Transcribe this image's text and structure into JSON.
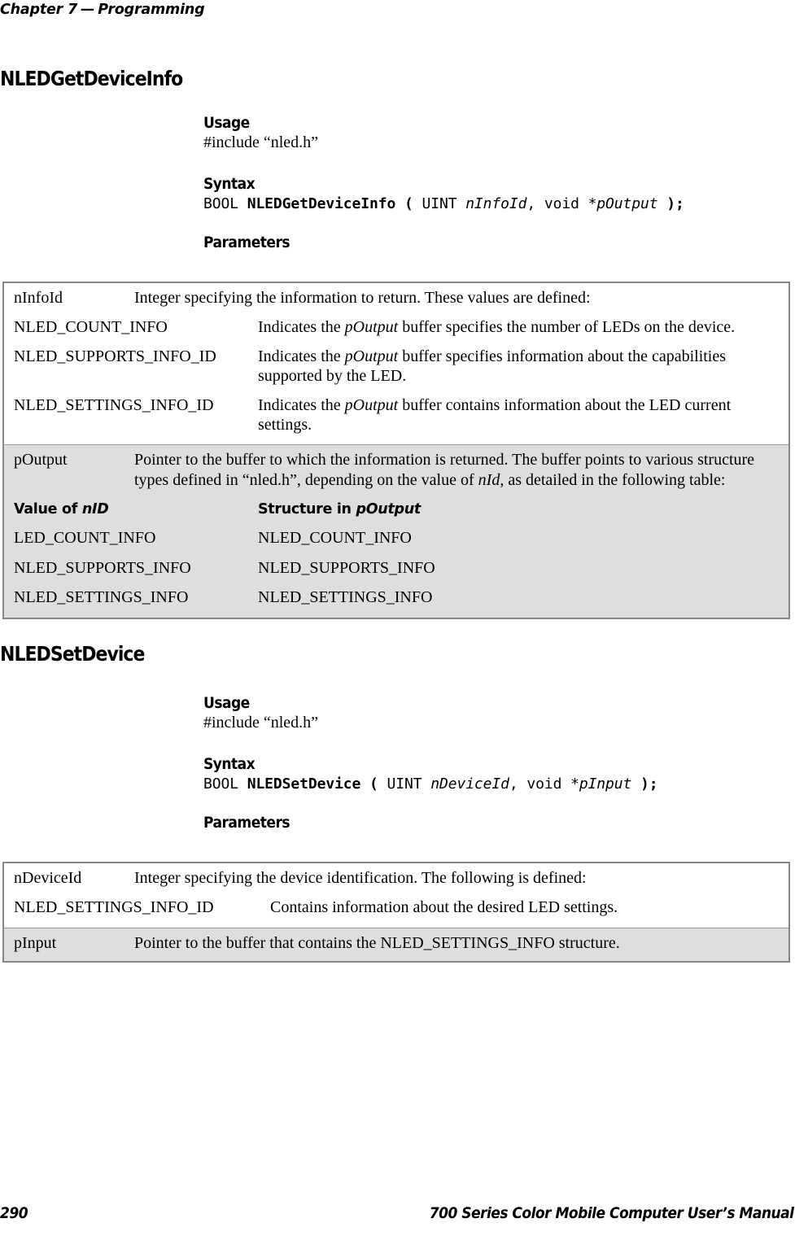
{
  "header": {
    "chapter": "Chapter 7",
    "dash": "—",
    "title": "Programming"
  },
  "sections": [
    {
      "heading": "NLEDGetDeviceInfo",
      "usage_label": "Usage",
      "usage_text": "#include “nled.h”",
      "syntax_label": "Syntax",
      "syntax": {
        "return_type": "BOOL",
        "function_name": "NLEDGetDeviceInfo",
        "paren_open": "(",
        "arg1_type": "UINT",
        "arg1_name": "nInfoId",
        "comma": ",",
        "arg2_type": "void",
        "arg2_name": "*pOutput",
        "paren_close": ");"
      },
      "parameters_label": "Parameters"
    },
    {
      "heading": "NLEDSetDevice",
      "usage_label": "Usage",
      "usage_text": "#include “nled.h”",
      "syntax_label": "Syntax",
      "syntax": {
        "return_type": "BOOL",
        "function_name": "NLEDSetDevice",
        "paren_open": "(",
        "arg1_type": "UINT",
        "arg1_name": "nDeviceId",
        "comma": ",",
        "arg2_type": "void",
        "arg2_name": "*pInput",
        "paren_close": ");"
      },
      "parameters_label": "Parameters"
    }
  ],
  "table1": {
    "row_ninfoid": {
      "label": "nInfoId",
      "intro": "Integer specifying the information to return. These values are defined:",
      "definitions": [
        {
          "term": "NLED_COUNT_INFO",
          "desc_pre": "Indicates the ",
          "desc_em": "pOutput",
          "desc_post": " buffer specifies the number of LEDs on the device."
        },
        {
          "term": "NLED_SUPPORTS_INFO_ID",
          "desc_pre": "Indicates the ",
          "desc_em": "pOutput",
          "desc_post": " buffer specifies information about the capabilities supported by the LED."
        },
        {
          "term": "NLED_SETTINGS_INFO_ID",
          "desc_pre": "Indicates the ",
          "desc_em": "pOutput",
          "desc_post": " buffer contains information about the LED current settings."
        }
      ]
    },
    "row_poutput": {
      "label": "pOutput",
      "intro_pre": "Pointer to the buffer to which the information is returned. The buffer points to various structure types defined in “nled.h”, depending on the value of ",
      "intro_em": "nId",
      "intro_post": ", as detailed in the following table:",
      "inner_header": {
        "col_a_pre": "Value of ",
        "col_a_em": "nID",
        "col_b_pre": "Structure in ",
        "col_b_em": "pOutput"
      },
      "inner_rows": [
        {
          "value": "LED_COUNT_INFO",
          "structure": "NLED_COUNT_INFO"
        },
        {
          "value": "NLED_SUPPORTS_INFO",
          "structure": "NLED_SUPPORTS_INFO"
        },
        {
          "value": "NLED_SETTINGS_INFO",
          "structure": "NLED_SETTINGS_INFO"
        }
      ]
    }
  },
  "table2": {
    "row_ndeviceid": {
      "label": "nDeviceId",
      "intro": "Integer specifying the device identification. The following is defined:",
      "definitions": [
        {
          "term": "NLED_SETTINGS_INFO_ID",
          "desc": "Contains information about the desired LED settings."
        }
      ]
    },
    "row_pinput": {
      "label": "pInput",
      "desc": "Pointer to the buffer that contains the NLED_SETTINGS_INFO structure."
    }
  },
  "footer": {
    "page_number": "290",
    "manual_title": "700 Series Color Mobile Computer User’s Manual"
  }
}
